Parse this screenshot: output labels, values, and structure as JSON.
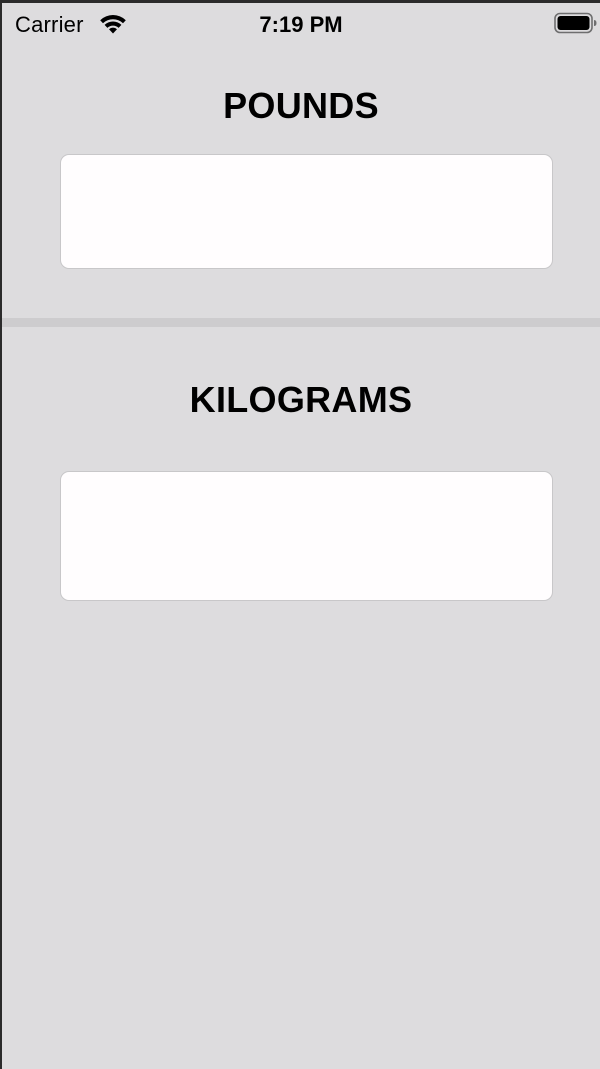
{
  "status_bar": {
    "carrier": "Carrier",
    "time": "7:19 PM",
    "wifi_icon": "wifi-icon",
    "battery_icon": "battery-icon"
  },
  "pounds": {
    "title": "POUNDS",
    "value": "",
    "placeholder": ""
  },
  "kilograms": {
    "title": "KILOGRAMS",
    "value": "",
    "placeholder": ""
  },
  "colors": {
    "background": "#dddcde",
    "field_background": "#fffdfe",
    "divider": "#cdccce",
    "text": "#000000"
  }
}
